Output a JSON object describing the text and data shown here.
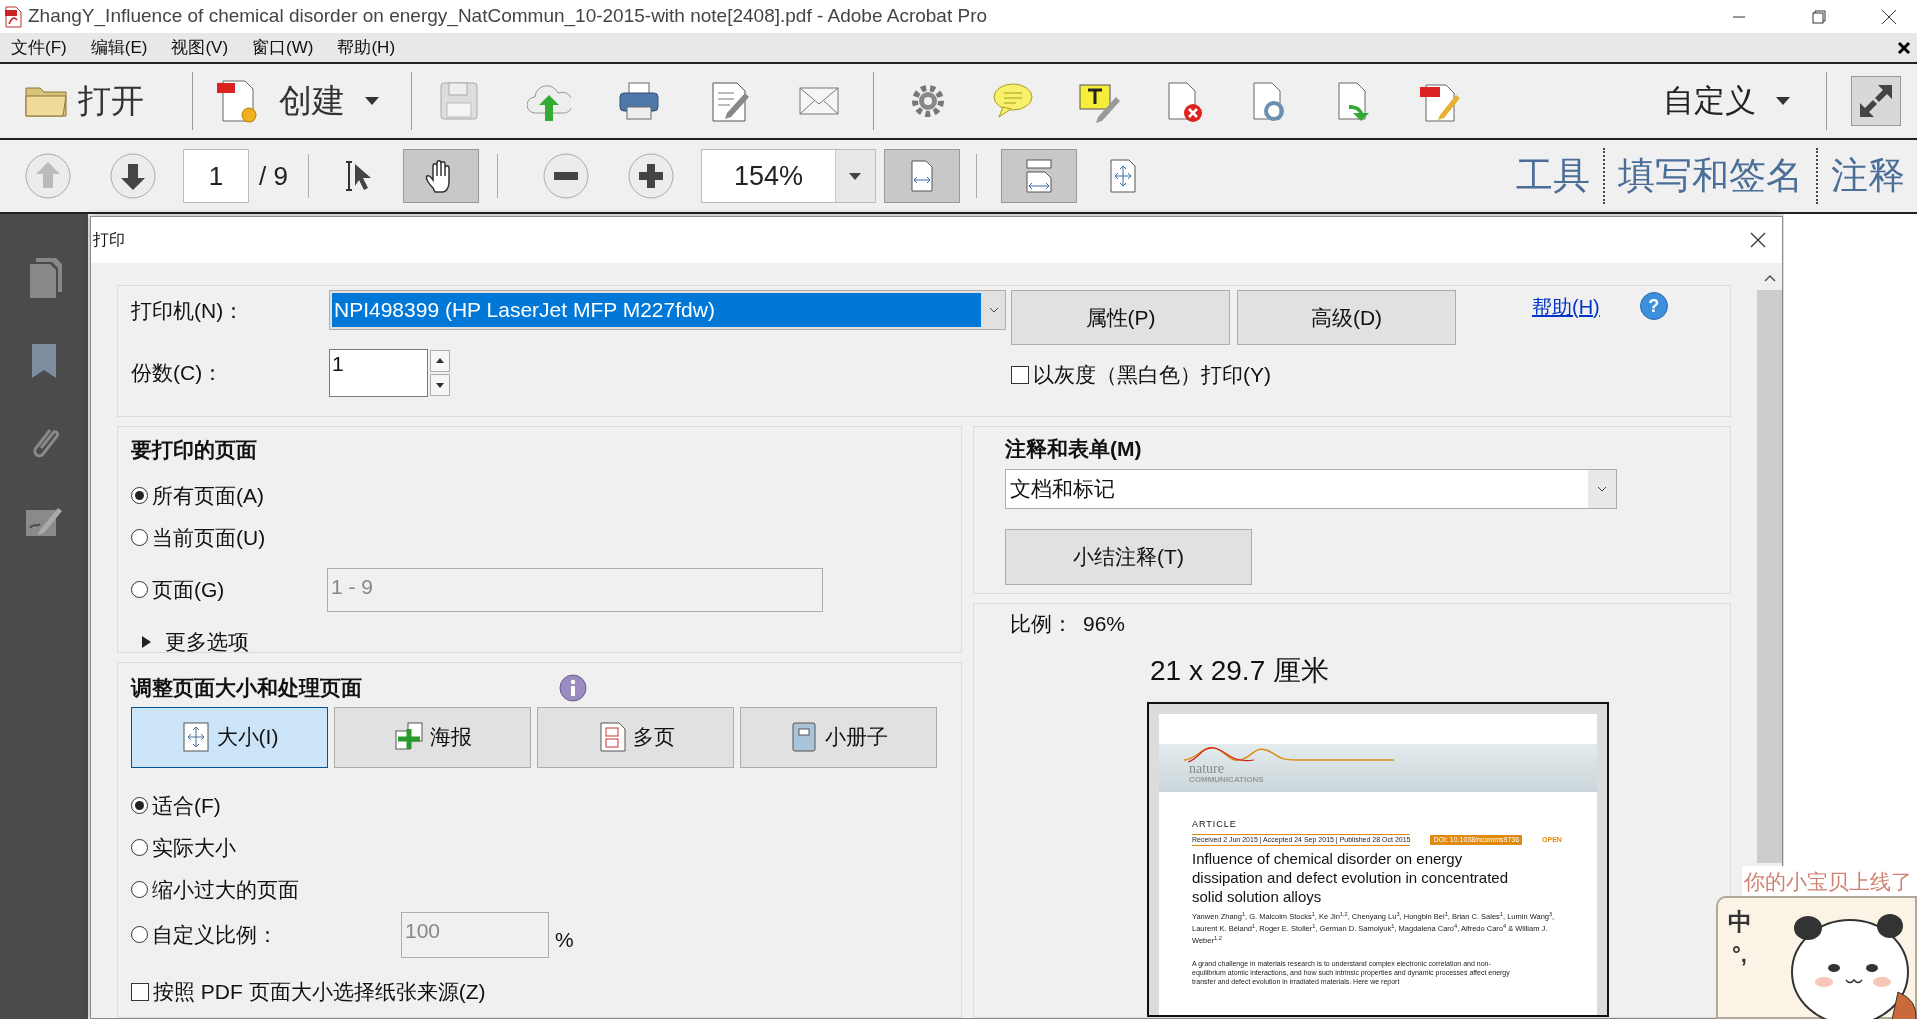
{
  "window": {
    "title": "ZhangY_Influence of chemical disorder on energy_NatCommun_10-2015-with note[2408].pdf - Adobe Acrobat Pro"
  },
  "menu": [
    "文件(F)",
    "编辑(E)",
    "视图(V)",
    "窗口(W)",
    "帮助(H)"
  ],
  "toolbar": {
    "open_label": "打开",
    "create_label": "创建",
    "customize_label": "自定义"
  },
  "nav": {
    "page": "1",
    "page_total": "/ 9",
    "zoom": "154%",
    "tools": [
      {
        "kind": "select",
        "selected": false
      },
      {
        "kind": "hand",
        "selected": true
      }
    ],
    "fit": [
      {
        "kind": "width",
        "selected": true
      },
      {
        "kind": "full",
        "selected": true
      },
      {
        "kind": "page",
        "selected": false
      }
    ]
  },
  "panes": [
    "工具",
    "填写和签名",
    "注释"
  ],
  "print_dialog": {
    "title": "打印",
    "printer_label": "打印机(N)：",
    "printer": "NPI498399 (HP LaserJet MFP M227fdw)",
    "buttons": [
      "属性(P)",
      "高级(D)"
    ],
    "help_link": "帮助(H)",
    "help_icon": "?",
    "copies_label": "份数(C)：",
    "copies": "1",
    "grayscale": {
      "label": "以灰度（黑白色）打印(Y)",
      "checked": false
    },
    "pages": {
      "heading": "要打印的页面",
      "range": "1 - 9",
      "more": "更多选项",
      "options": [
        {
          "label": "所有页面(A)",
          "selected": true
        },
        {
          "label": "当前页面(U)",
          "selected": false
        },
        {
          "label": "页面(G)",
          "selected": false
        }
      ]
    },
    "comments": {
      "heading": "注释和表单(M)",
      "value": "文档和标记",
      "summarize": "小结注释(T)"
    },
    "sizing": {
      "heading": "调整页面大小和处理页面",
      "modes": [
        {
          "kind": "size",
          "label": "大小(I)",
          "selected": true
        },
        {
          "kind": "poster",
          "label": "海报",
          "selected": false
        },
        {
          "kind": "multiple",
          "label": "多页",
          "selected": false
        },
        {
          "kind": "booklet",
          "label": "小册子",
          "selected": false
        }
      ],
      "options": [
        {
          "label": "适合(F)",
          "selected": true
        },
        {
          "label": "实际大小",
          "selected": false
        },
        {
          "label": "缩小过大的页面",
          "selected": false
        },
        {
          "label": "自定义比例：",
          "selected": false
        }
      ],
      "custom_scale": "100",
      "percent": "%",
      "paper_source": {
        "label": "按照 PDF 页面大小选择纸张来源(Z)",
        "checked": false
      }
    },
    "preview": {
      "scale_label": "比例：",
      "scale": "96%",
      "paper_size": "21 x 29.7 厘米",
      "page": {
        "journal": "nature",
        "journal_sub": "COMMUNICATIONS",
        "type": "ARTICLE",
        "dates": "Received 2 Jun 2015 | Accepted 24 Sep 2015 | Published 28 Oct 2015",
        "doi": "DOI: 10.1038/ncomms9736",
        "access": "OPEN",
        "title": "Influence of chemical disorder on energy dissipation and defect evolution in concentrated solid solution alloys",
        "authors": "Yanwen Zhang$^{1}$, G. Malcolm Stocks$^{1}$, Ke Jin$^{1,2}$, Chenyang Lu$^{3}$, Hongbin Bei$^{1}$, Brian C. Sales$^{1}$, Lumin Wang$^{3}$, Laurent K. Béland$^{1}$, Roger E. Stoller$^{1}$, German D. Samolyuk$^{1}$, Magdalena Caro$^{4}$, Alfredo Caro$^{4}$ & William J. Weber$^{1,2}$",
        "abstract": "A grand challenge in materials research is to understand complex electronic correlation and non-equilibrium atomic interactions, and how such intrinsic properties and dynamic processes affect energy transfer and defect evolution in irradiated materials. Here we report"
      }
    }
  },
  "ime": {
    "mode": "中",
    "punct": "°,",
    "caption": "你的小宝贝上线了"
  }
}
